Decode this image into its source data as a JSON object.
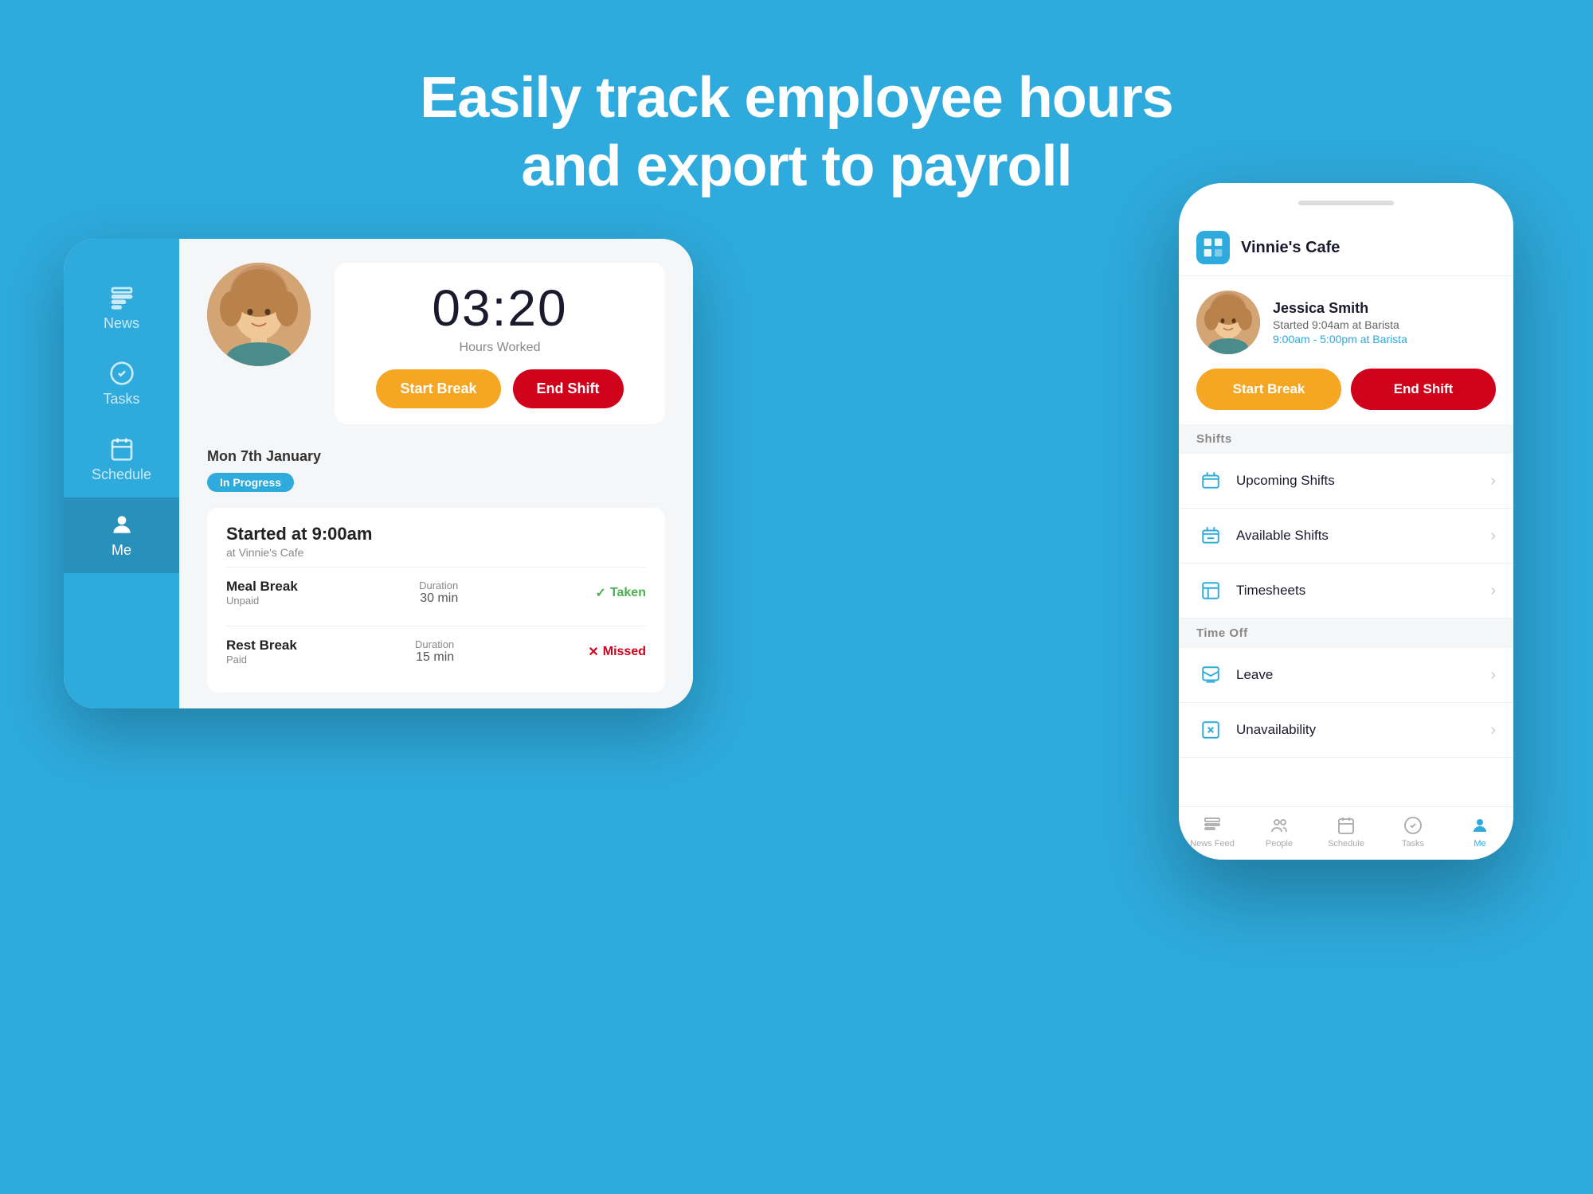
{
  "page": {
    "background_color": "#2EAADC",
    "headline_line1": "Easily track employee hours",
    "headline_line2": "and export to payroll"
  },
  "tablet": {
    "sidebar": {
      "items": [
        {
          "id": "news",
          "label": "News",
          "active": false
        },
        {
          "id": "tasks",
          "label": "Tasks",
          "active": false
        },
        {
          "id": "schedule",
          "label": "Schedule",
          "active": false
        },
        {
          "id": "me",
          "label": "Me",
          "active": true
        }
      ]
    },
    "hours": {
      "time": "03:20",
      "label": "Hours Worked"
    },
    "buttons": {
      "start_break": "Start Break",
      "end_shift": "End Shift"
    },
    "shift": {
      "date": "Mon 7th January",
      "status_badge": "In Progress",
      "started_at": "Started at 9:00am",
      "location": "at Vinnie's Cafe",
      "breaks": [
        {
          "name": "Meal Break",
          "type": "Unpaid",
          "duration_label": "Duration",
          "duration_value": "30 min",
          "status": "Taken",
          "status_type": "taken"
        },
        {
          "name": "Rest Break",
          "type": "Paid",
          "duration_label": "Duration",
          "duration_value": "15 min",
          "status": "Missed",
          "status_type": "missed"
        }
      ]
    }
  },
  "phone": {
    "cafe_name": "Vinnie's Cafe",
    "user": {
      "name": "Jessica Smith",
      "started": "Started 9:04am at Barista",
      "shift_time": "9:00am - 5:00pm at Barista"
    },
    "buttons": {
      "start_break": "Start Break",
      "end_shift": "End Shift"
    },
    "shifts_section_label": "Shifts",
    "menu_items": [
      {
        "id": "upcoming-shifts",
        "label": "Upcoming Shifts",
        "icon_type": "upcoming"
      },
      {
        "id": "available-shifts",
        "label": "Available Shifts",
        "icon_type": "available"
      },
      {
        "id": "timesheets",
        "label": "Timesheets",
        "icon_type": "timesheets"
      }
    ],
    "time_off_section_label": "Time Off",
    "time_off_items": [
      {
        "id": "leave",
        "label": "Leave",
        "icon_type": "leave"
      },
      {
        "id": "unavailability",
        "label": "Unavailability",
        "icon_type": "unavailability"
      }
    ],
    "bottom_nav": [
      {
        "id": "news-feed",
        "label": "News Feed",
        "active": false
      },
      {
        "id": "people",
        "label": "People",
        "active": false
      },
      {
        "id": "schedule",
        "label": "Schedule",
        "active": false
      },
      {
        "id": "tasks",
        "label": "Tasks",
        "active": false
      },
      {
        "id": "me",
        "label": "Me",
        "active": true
      }
    ]
  }
}
